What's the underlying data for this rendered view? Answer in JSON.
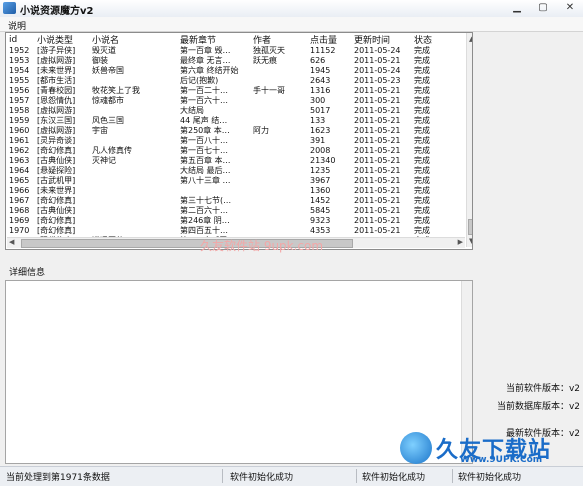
{
  "window": {
    "title": "小说资源魔方v2"
  },
  "menu": {
    "items": [
      "说明"
    ]
  },
  "table": {
    "columns": [
      "id",
      "小说类型",
      "小说名",
      "最新章节",
      "作者",
      "点击量",
      "更新时间",
      "状态"
    ],
    "rows": [
      [
        "1952",
        "[游子异侠]",
        "毁灭道",
        "第一百章 毁…",
        "独孤灭天",
        "11152",
        "2011-05-24",
        "完成"
      ],
      [
        "1953",
        "[虚拟网游]",
        "御装",
        "最终章 无言…",
        "跃无痕",
        "626",
        "2011-05-21",
        "完成"
      ],
      [
        "1954",
        "[未来世界]",
        "妖兽帝国",
        "第六章 终结开始",
        "",
        "1945",
        "2011-05-24",
        "完成"
      ],
      [
        "1955",
        "[都市生活]",
        "",
        "后记(抱歉)",
        "",
        "2643",
        "2011-05-23",
        "完成"
      ],
      [
        "1956",
        "[青春校园]",
        "牧花笑上了我",
        "第一百二十…",
        "手十一哥",
        "1316",
        "2011-05-21",
        "完成"
      ],
      [
        "1957",
        "[恩怨情仇]",
        "惊魂都市",
        "第一百六十…",
        "",
        "300",
        "2011-05-21",
        "完成"
      ],
      [
        "1958",
        "[虚拟网游]",
        "",
        "大结局",
        "",
        "5017",
        "2011-05-21",
        "完成"
      ],
      [
        "1959",
        "[东汉三国]",
        "风色三国",
        "44 尾声 结…",
        "",
        "133",
        "2011-05-21",
        "完成"
      ],
      [
        "1960",
        "[虚拟网游]",
        "宇宙",
        "第250章 本…",
        "阿力",
        "1623",
        "2011-05-21",
        "完成"
      ],
      [
        "1961",
        "[灵异奇谈]",
        "",
        "第一百八十…",
        "",
        "391",
        "2011-05-21",
        "完成"
      ],
      [
        "1962",
        "[奇幻修真]",
        "凡人修真传",
        "第一百七十…",
        "",
        "2008",
        "2011-05-21",
        "完成"
      ],
      [
        "1963",
        "[古典仙侠]",
        "灭神记",
        "第五百章 本…",
        "",
        "21340",
        "2011-05-21",
        "完成"
      ],
      [
        "1964",
        "[悬疑探险]",
        "",
        "大结局 最后…",
        "",
        "1235",
        "2011-05-21",
        "完成"
      ],
      [
        "1965",
        "[古武机甲]",
        "",
        "第八十三章 …",
        "",
        "3967",
        "2011-05-21",
        "完成"
      ],
      [
        "1966",
        "[未来世界]",
        "",
        "",
        "",
        "1360",
        "2011-05-21",
        "完成"
      ],
      [
        "1967",
        "[奇幻修真]",
        "",
        "第三十七节(…",
        "",
        "1452",
        "2011-05-21",
        "完成"
      ],
      [
        "1968",
        "[古典仙侠]",
        "",
        "第二百六十…",
        "",
        "5845",
        "2011-05-21",
        "完成"
      ],
      [
        "1969",
        "[奇幻修真]",
        "",
        "第246章 阴…",
        "",
        "9323",
        "2011-05-21",
        "完成"
      ],
      [
        "1970",
        "[奇幻修真]",
        "",
        "第四百五十…",
        "",
        "4353",
        "2011-05-21",
        "完成"
      ],
      [
        "1971",
        "[现代修真]",
        "逍遥医仙",
        "第168章【无…",
        "",
        "8140",
        "2011-05-21",
        "完成"
      ]
    ]
  },
  "detail": {
    "label": "详细信息"
  },
  "versions": {
    "software": "当前软件版本：v2",
    "database": "当前数据库版本：v2",
    "latest": "最新软件版本：v2"
  },
  "statusbar": {
    "processed": "当前处理到第1971条数据",
    "init1": "软件初始化成功",
    "init2": "软件初始化成功",
    "init3": "软件初始化成功"
  },
  "watermark": {
    "site_mid": "久友软件站 9upk.com",
    "brand": "久友下载站",
    "url": "Www.9UPK.Com"
  }
}
